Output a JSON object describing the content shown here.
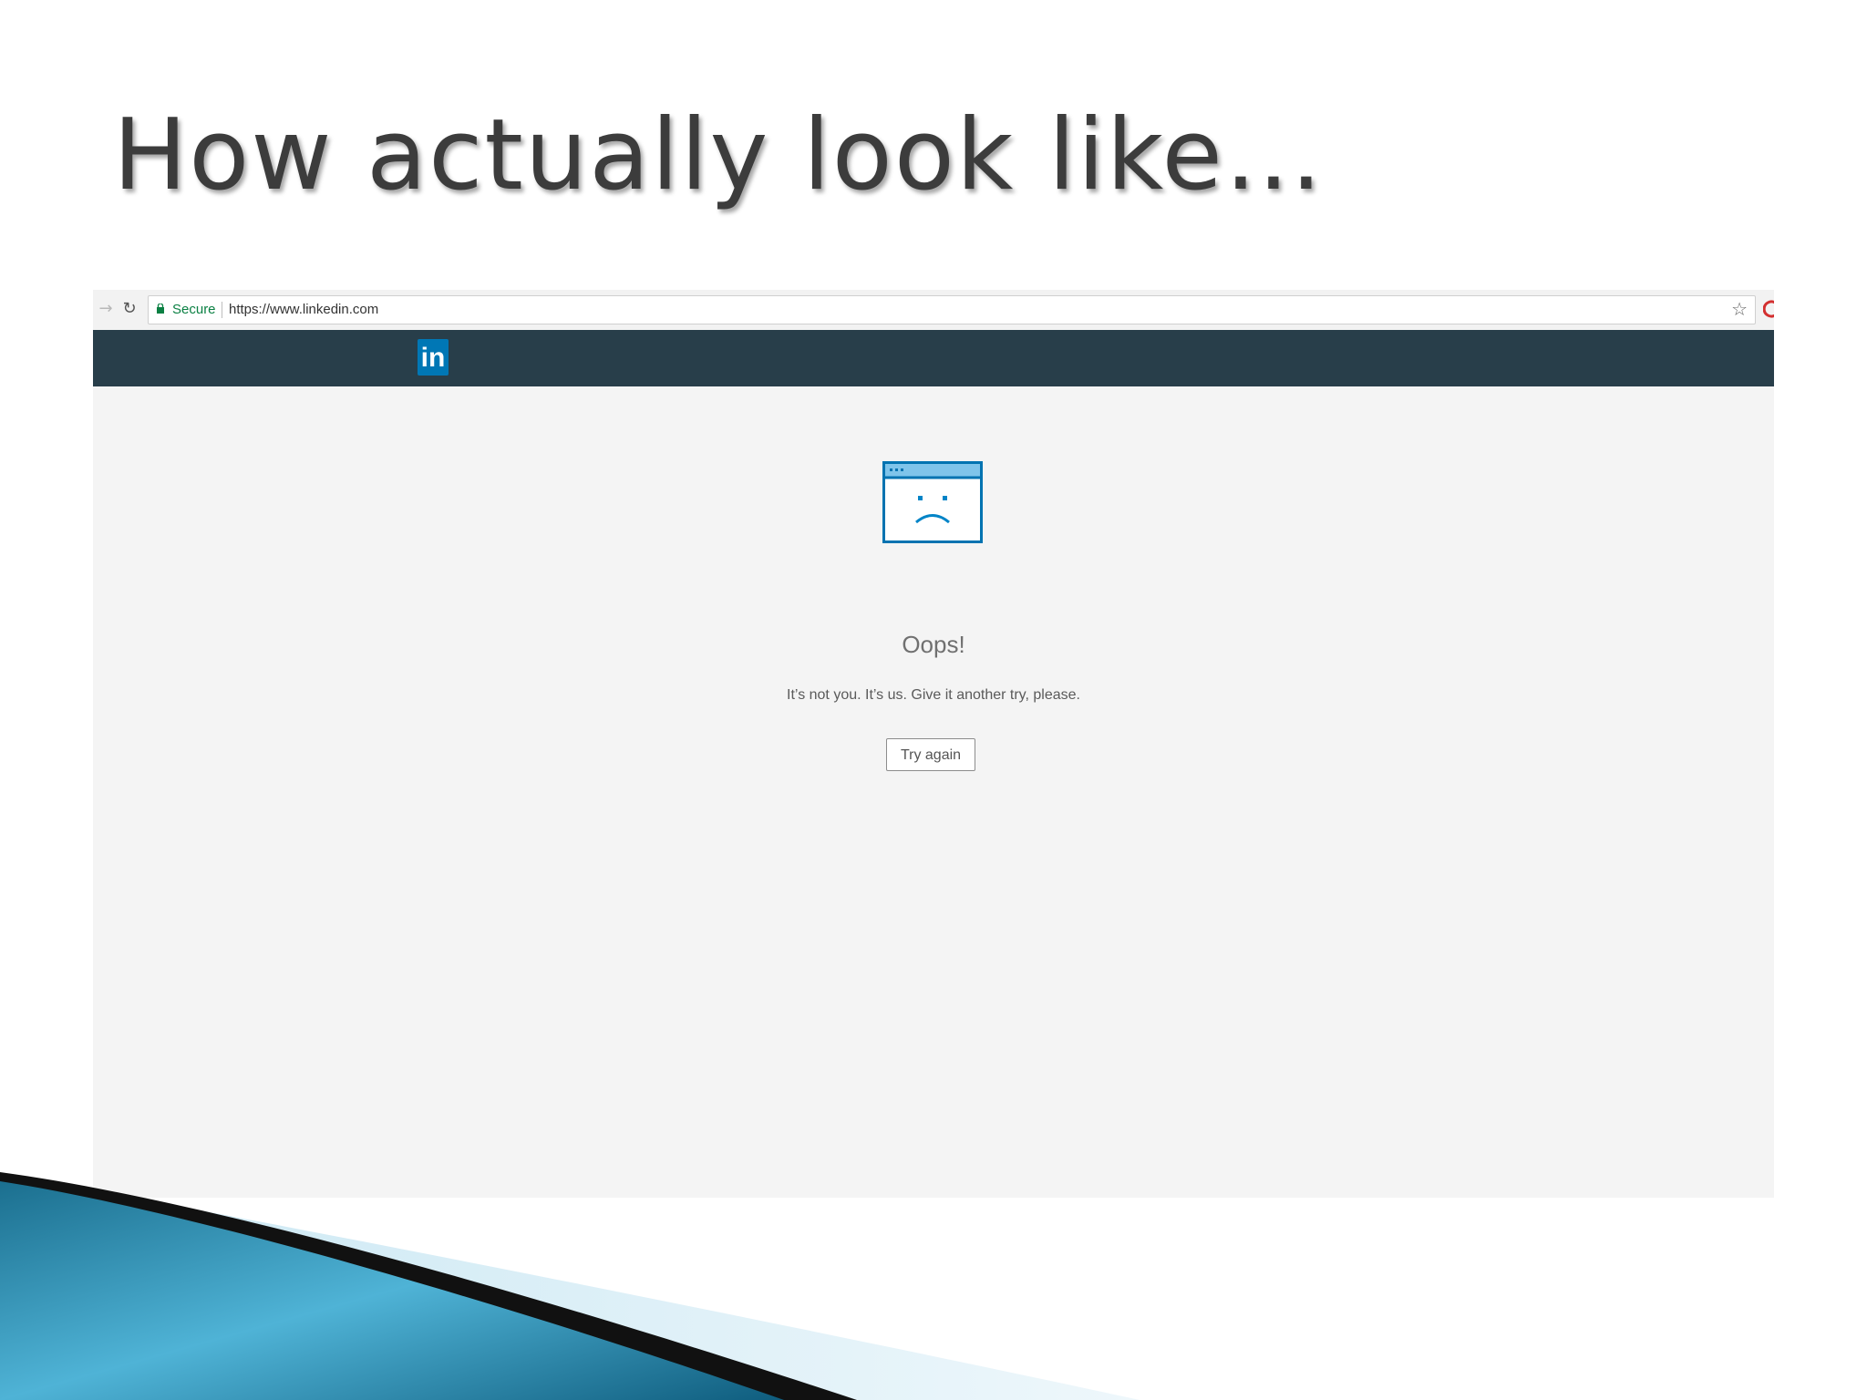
{
  "slide": {
    "title": "How actually look like…"
  },
  "browser": {
    "forward_icon": "arrow-right-icon",
    "reload_icon": "reload-icon",
    "secure_label": "Secure",
    "url": "https://www.linkedin.com",
    "bookmark_icon": "star-icon",
    "extension_icon": "extension-icon"
  },
  "site": {
    "logo_text": "in",
    "logo_color": "#0077b5",
    "header_color": "#283e4a"
  },
  "error_page": {
    "illustration_icon": "sad-browser-window-icon",
    "heading": "Oops!",
    "message": "It’s not you. It’s us. Give it another try, please.",
    "button_label": "Try again",
    "accent_color": "#0073b1"
  }
}
